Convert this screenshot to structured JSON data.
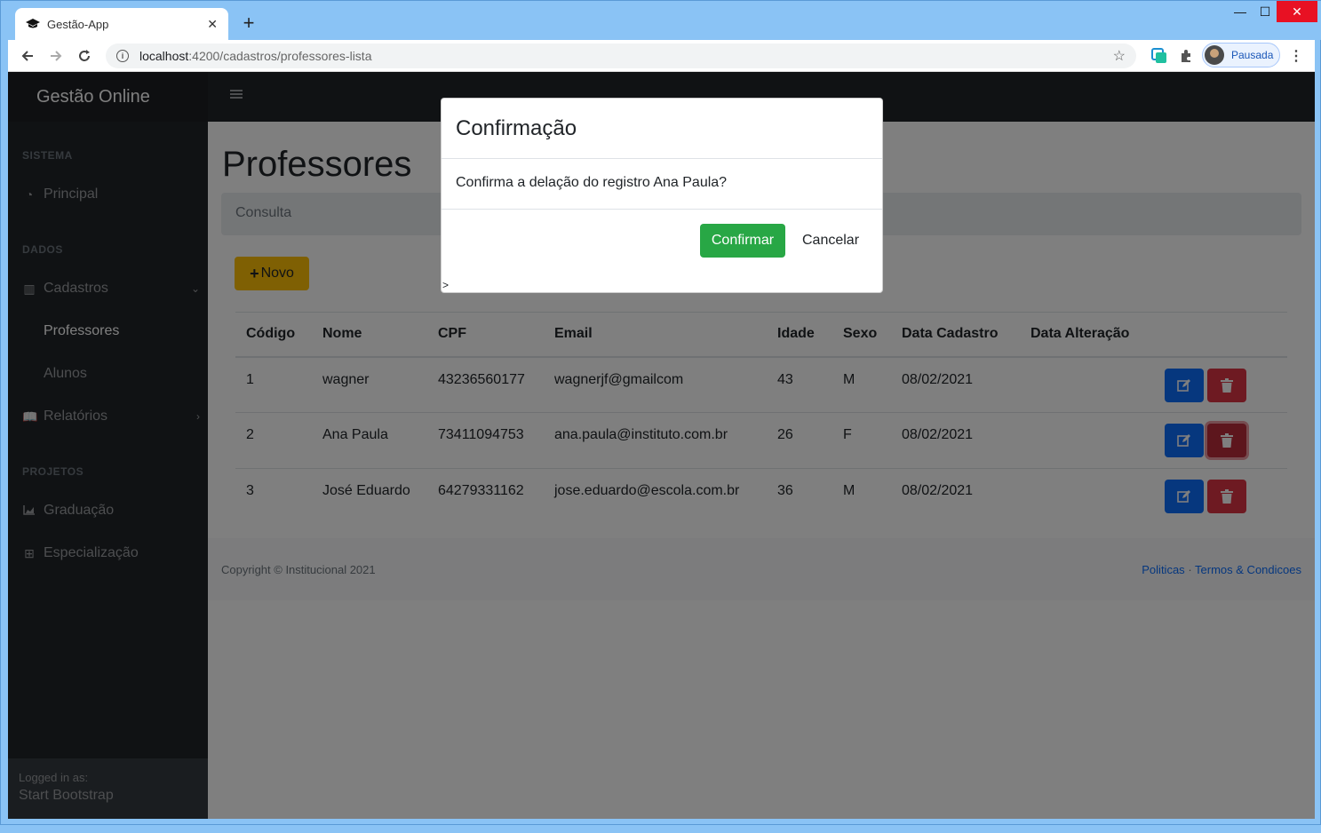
{
  "browser": {
    "tab_title": "Gestão-App",
    "tab_close": "✕",
    "new_tab": "+",
    "url_host": "localhost",
    "url_path": ":4200/cadastros/professores-lista",
    "profile_label": "Pausada",
    "controls": {
      "minimize": "—",
      "maximize": "☐",
      "close": "✕"
    }
  },
  "app": {
    "brand": "Gestão Online",
    "sidebar": {
      "headings": [
        "SISTEMA",
        "DADOS",
        "PROJETOS"
      ],
      "items": [
        {
          "label": "Principal",
          "icon": "dashboard-icon"
        },
        {
          "label": "Cadastros",
          "icon": "columns-icon"
        },
        {
          "label": "Professores"
        },
        {
          "label": "Alunos"
        },
        {
          "label": "Relatórios",
          "icon": "book-icon"
        },
        {
          "label": "Graduação",
          "icon": "chart-area-icon"
        },
        {
          "label": "Especialização",
          "icon": "table-icon"
        }
      ],
      "footer_small": "Logged in as:",
      "footer_name": "Start Bootstrap"
    },
    "page_title": "Professores",
    "breadcrumb": "Consulta",
    "new_button": "Novo",
    "table": {
      "headers": [
        "Código",
        "Nome",
        "CPF",
        "Email",
        "Idade",
        "Sexo",
        "Data Cadastro",
        "Data Alteração"
      ],
      "rows": [
        [
          "1",
          "wagner",
          "43236560177",
          "wagnerjf@gmailcom",
          "43",
          "M",
          "08/02/2021",
          ""
        ],
        [
          "2",
          "Ana Paula",
          "73411094753",
          "ana.paula@instituto.com.br",
          "26",
          "F",
          "08/02/2021",
          ""
        ],
        [
          "3",
          "José Eduardo",
          "64279331162",
          "jose.eduardo@escola.com.br",
          "36",
          "M",
          "08/02/2021",
          ""
        ]
      ]
    },
    "footer": {
      "copyright": "Copyright © Institucional 2021",
      "link1": "Politicas",
      "sep": "·",
      "link2": "Termos & Condicoes"
    }
  },
  "modal": {
    "title": "Confirmação",
    "body": "Confirma a delação do registro Ana Paula?",
    "confirm": "Confirmar",
    "cancel": "Cancelar",
    "stray": ">"
  },
  "colors": {
    "confirm": "#28a745",
    "edit": "#0d6efd",
    "delete": "#dc3545",
    "new": "#ffc107",
    "sidebar": "#212529"
  }
}
